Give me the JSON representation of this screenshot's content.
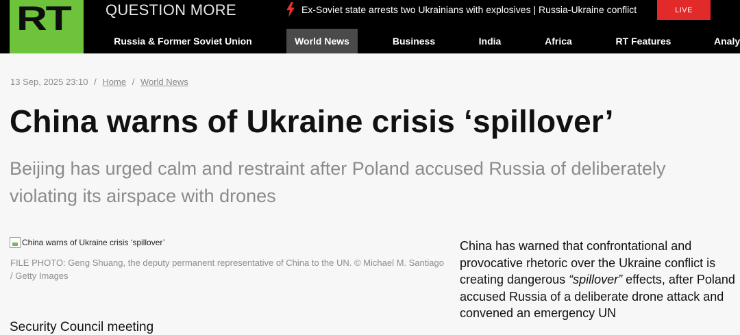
{
  "header": {
    "logo_text": "RT",
    "tagline": "QUESTION MORE",
    "breaking": {
      "icon": "lightning-bolt-icon",
      "text": "Ex-Soviet state arrests two Ukrainians with explosives | Russia-Ukraine conflict"
    },
    "live_label": "LIVE",
    "colors": {
      "brand_green": "#6ec33c",
      "live_red": "#e32a2a",
      "bolt_red": "#e8322e"
    }
  },
  "nav": {
    "items": [
      {
        "label": "Russia & Former Soviet Union",
        "active": false
      },
      {
        "label": "World News",
        "active": true
      },
      {
        "label": "Business",
        "active": false
      },
      {
        "label": "India",
        "active": false
      },
      {
        "label": "Africa",
        "active": false
      },
      {
        "label": "RT Features",
        "active": false
      },
      {
        "label": "Analy",
        "active": false
      }
    ]
  },
  "article": {
    "datetime": "13 Sep, 2025 23:10",
    "breadcrumb": [
      "Home",
      "World News"
    ],
    "title": "China warns of Ukraine crisis ‘spillover’",
    "subtitle": "Beijing has urged calm and restraint after Poland accused Russia of deliberately violating its airspace with drones",
    "image_alt": "China warns of Ukraine crisis ‘spillover’",
    "caption": "FILE PHOTO: Geng Shuang, the deputy permanent representative of China to the UN. ©  Michael M. Santiago / Getty Images",
    "body_part1": "China has warned that confrontational and provocative rhetoric over the Ukraine conflict is creating dangerous ",
    "body_emphasis": "“spillover”",
    "body_part2": " effects, after Poland accused Russia of a deliberate drone attack and convened an emergency UN",
    "continued_text": "Security Council meeting"
  }
}
